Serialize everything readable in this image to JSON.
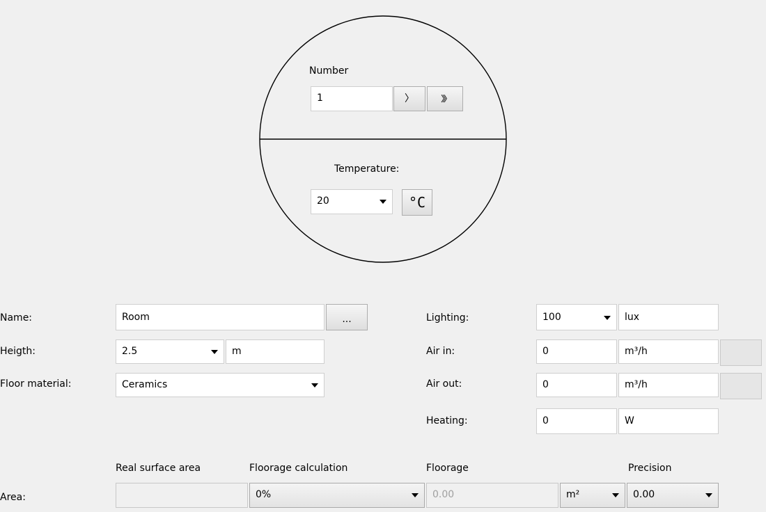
{
  "circle": {
    "number_label": "Number",
    "number_value": "1",
    "next_label": "〉",
    "fast_forward_label": "〉〉〉",
    "temperature_label": "Temperature:",
    "temperature_value": "20",
    "unit_label": "°C"
  },
  "form": {
    "name_label": "Name:",
    "name_value": "Room",
    "browse_label": "...",
    "height_label": "Heigth:",
    "height_value": "2.5",
    "height_unit": "m",
    "floor_label": "Floor material:",
    "floor_value": "Ceramics",
    "lighting_label": "Lighting:",
    "lighting_value": "100",
    "lighting_unit": "lux",
    "air_in_label": "Air in:",
    "air_in_value": "0",
    "air_in_unit": "m³/h",
    "air_out_label": "Air out:",
    "air_out_value": "0",
    "air_out_unit": "m³/h",
    "heating_label": "Heating:",
    "heating_value": "0",
    "heating_unit": "W"
  },
  "area": {
    "real_surface_header": "Real surface area",
    "floorage_calc_header": "Floorage calculation",
    "floorage_header": "Floorage",
    "precision_header": "Precision",
    "area_label": "Area:",
    "real_surface_value": "",
    "floorage_calc_value": "0%",
    "floorage_value": "0.00",
    "floorage_unit": "m²",
    "precision_value": "0.00"
  }
}
